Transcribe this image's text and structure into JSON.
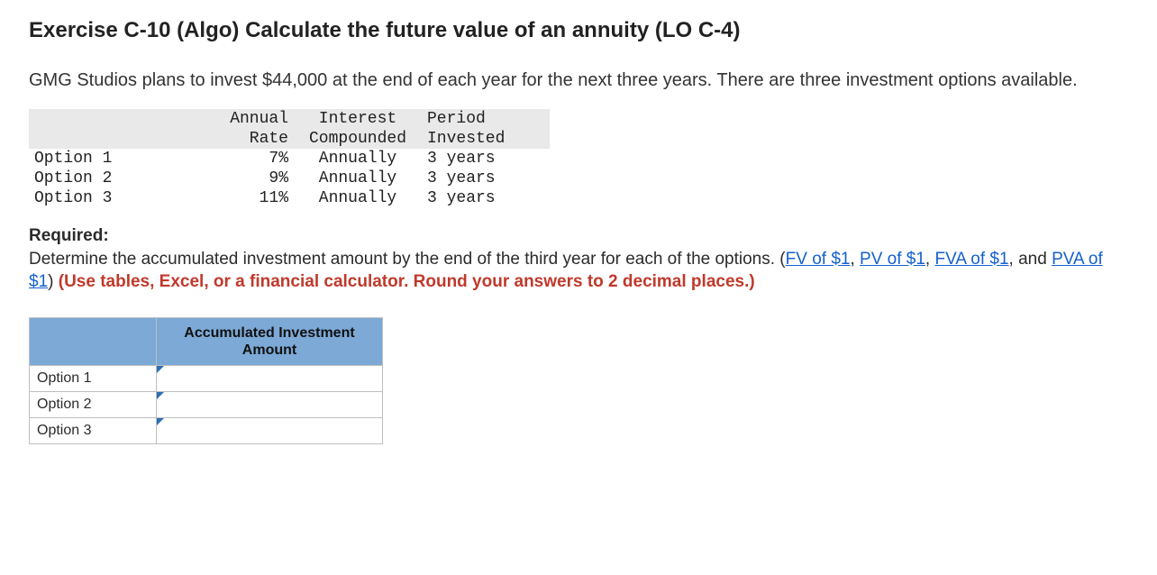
{
  "title": "Exercise C-10 (Algo) Calculate the future value of an annuity (LO C-4)",
  "intro": "GMG Studios plans to invest $44,000 at the end of each year for the next three years. There are three investment options available.",
  "options_table": {
    "headers": {
      "rate_line1": "Annual",
      "rate_line2": "Rate",
      "comp_line1": "Interest",
      "comp_line2": "Compounded",
      "period_line1": "Period",
      "period_line2": "Invested"
    },
    "rows": [
      {
        "label": "Option 1",
        "rate": "7%",
        "compounded": "Annually",
        "period": "3 years"
      },
      {
        "label": "Option 2",
        "rate": "9%",
        "compounded": "Annually",
        "period": "3 years"
      },
      {
        "label": "Option 3",
        "rate": "11%",
        "compounded": "Annually",
        "period": "3 years"
      }
    ]
  },
  "required": {
    "label": "Required:",
    "text_before_links": "Determine the accumulated investment amount by the end of the third year for each of the options. (",
    "links": {
      "fv": "FV of $1",
      "pv": "PV of $1",
      "fva": "FVA of $1",
      "pva": "PVA of $1"
    },
    "sep_comma": ", ",
    "sep_and": ", and ",
    "close_paren": ") ",
    "note": "(Use tables, Excel, or a financial calculator. Round your answers to 2 decimal places.)"
  },
  "answer_table": {
    "header_line1": "Accumulated Investment",
    "header_line2": "Amount",
    "rows": [
      {
        "label": "Option 1",
        "value": ""
      },
      {
        "label": "Option 2",
        "value": ""
      },
      {
        "label": "Option 3",
        "value": ""
      }
    ]
  }
}
